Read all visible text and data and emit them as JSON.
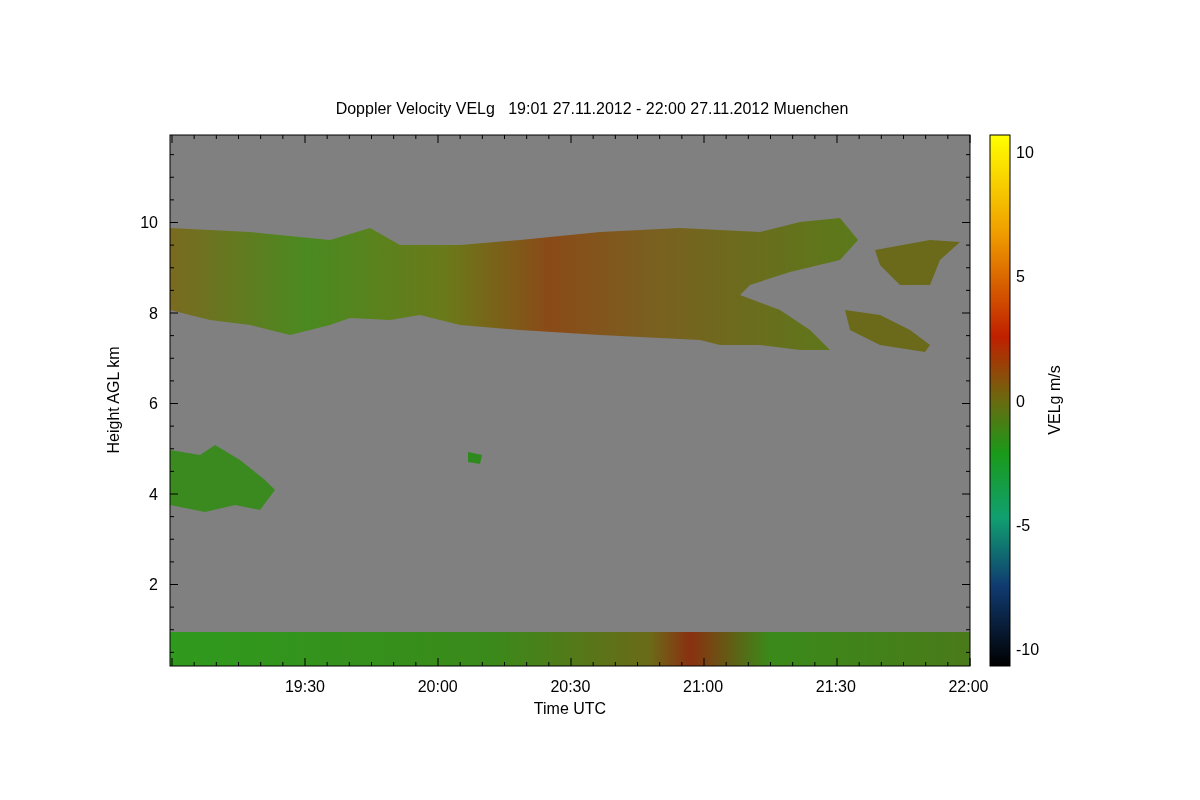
{
  "figure": {
    "title": "Doppler Velocity VELg   19:01 27.11.2012 - 22:00 27.11.2012 Muenchen",
    "xlabel": "Time UTC",
    "ylabel": "Height AGL km",
    "xticks": [
      "19:30",
      "20:00",
      "20:30",
      "21:00",
      "21:30",
      "22:00"
    ],
    "yticks": [
      "10",
      "8",
      "6",
      "4",
      "2"
    ]
  },
  "colorbar": {
    "label": "VELg m/s",
    "ticks": [
      "10",
      "5",
      "0",
      "-5",
      "-10"
    ]
  }
}
